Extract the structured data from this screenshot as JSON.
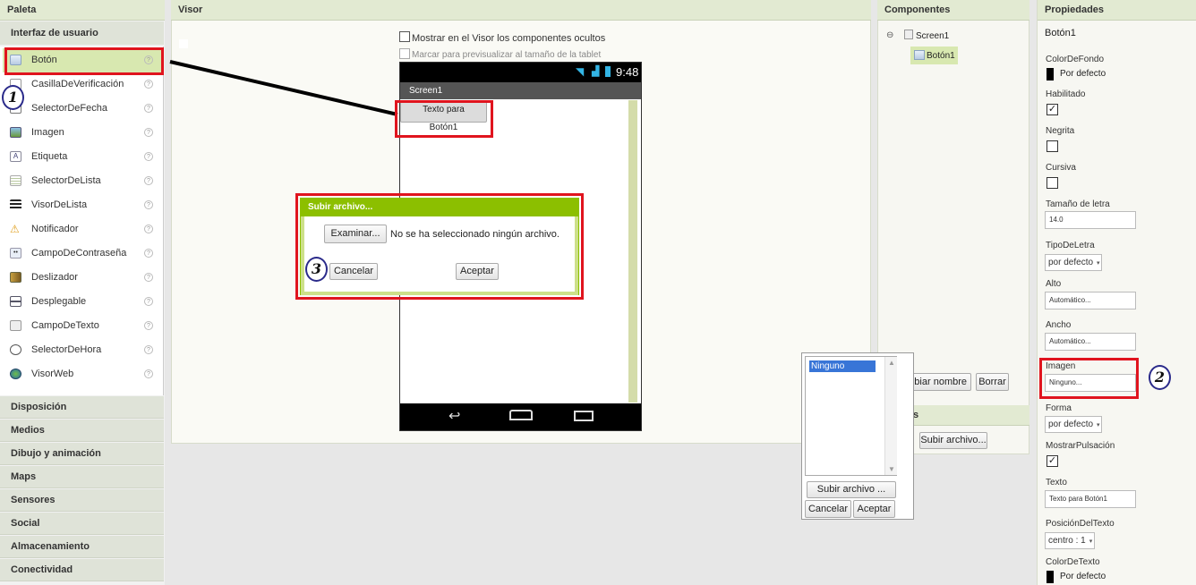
{
  "palette": {
    "title": "Paleta",
    "section": "Interfaz de usuario",
    "items": [
      {
        "label": "Botón",
        "icon": "button-icon",
        "selected": true
      },
      {
        "label": "CasillaDeVerificación",
        "icon": "checkbox-icon"
      },
      {
        "label": "SelectorDeFecha",
        "icon": "datepicker-icon"
      },
      {
        "label": "Imagen",
        "icon": "image-icon"
      },
      {
        "label": "Etiqueta",
        "icon": "label-icon"
      },
      {
        "label": "SelectorDeLista",
        "icon": "listpicker-icon"
      },
      {
        "label": "VisorDeLista",
        "icon": "listview-icon"
      },
      {
        "label": "Notificador",
        "icon": "notifier-icon"
      },
      {
        "label": "CampoDeContraseña",
        "icon": "password-icon"
      },
      {
        "label": "Deslizador",
        "icon": "slider-icon"
      },
      {
        "label": "Desplegable",
        "icon": "spinner-icon"
      },
      {
        "label": "CampoDeTexto",
        "icon": "textbox-icon"
      },
      {
        "label": "SelectorDeHora",
        "icon": "timepicker-icon"
      },
      {
        "label": "VisorWeb",
        "icon": "webviewer-icon"
      }
    ],
    "help_glyph": "?",
    "categories": [
      "Disposición",
      "Medios",
      "Dibujo y animación",
      "Maps",
      "Sensores",
      "Social",
      "Almacenamiento",
      "Conectividad"
    ]
  },
  "viewer": {
    "title": "Visor",
    "show_hidden_label": "Mostrar en el Visor los componentes ocultos",
    "tablet_preview_label": "Marcar para previsualizar al tamaño de la tablet",
    "status_time": "9:48",
    "screen_title": "Screen1",
    "button_text_line1": "Texto para",
    "button_text_line2": "Botón1"
  },
  "upload_dialog": {
    "title": "Subir archivo...",
    "browse_label": "Examinar...",
    "no_file_label": "No se ha seleccionado ningún archivo.",
    "cancel_label": "Cancelar",
    "accept_label": "Aceptar"
  },
  "components": {
    "title": "Componentes",
    "tree_toggle": "⊖",
    "root": "Screen1",
    "child": "Botón1",
    "rename_label": "mbiar nombre",
    "delete_label": "Borrar",
    "media_header_partial": "s",
    "upload_label": "Subir archivo..."
  },
  "image_picker": {
    "selected_option": "Ninguno",
    "upload_label": "Subir archivo ...",
    "cancel_label": "Cancelar",
    "accept_label": "Aceptar"
  },
  "properties": {
    "title": "Propiedades",
    "component": "Botón1",
    "background_color_label": "ColorDeFondo",
    "background_color_value": "Por defecto",
    "enabled_label": "Habilitado",
    "enabled_checked": "✓",
    "bold_label": "Negrita",
    "italic_label": "Cursiva",
    "font_size_label": "Tamaño de letra",
    "font_size_value": "14.0",
    "font_type_label": "TipoDeLetra",
    "font_type_value": "por defecto",
    "height_label": "Alto",
    "height_value": "Automático...",
    "width_label": "Ancho",
    "width_value": "Automático...",
    "image_label": "Imagen",
    "image_value": "Ninguno...",
    "shape_label": "Forma",
    "shape_value": "por defecto",
    "show_feedback_label": "MostrarPulsación",
    "show_feedback_checked": "✓",
    "text_label": "Texto",
    "text_value": "Texto para Botón1",
    "text_align_label": "PosiciónDelTexto",
    "text_align_value": "centro : 1",
    "text_color_label": "ColorDeTexto",
    "text_color_value": "Por defecto"
  },
  "markers": [
    "1",
    "2",
    "3"
  ],
  "colors": {
    "accent_green": "#8cbf00",
    "annotation_red": "#e0141e",
    "marker_blue": "#2a2a8a"
  }
}
